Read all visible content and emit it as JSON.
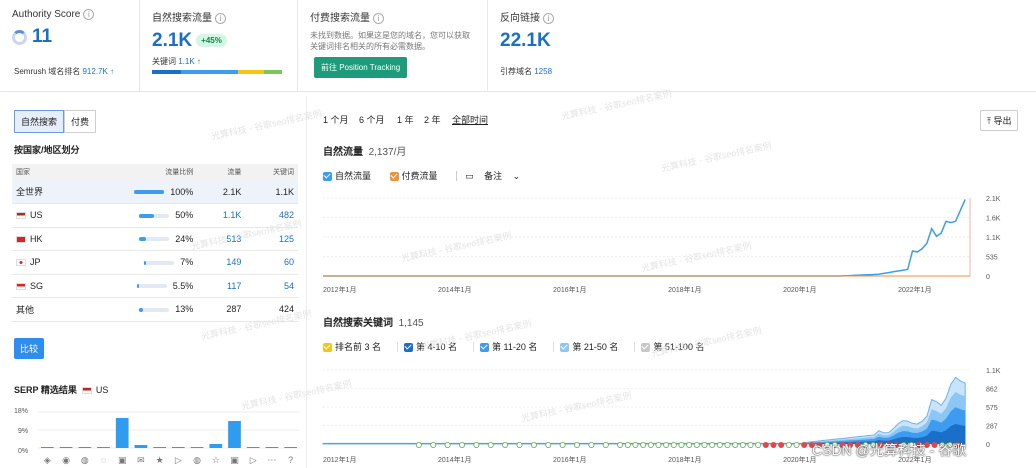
{
  "cards": {
    "authority": {
      "title": "Authority Score",
      "value": "11",
      "sub_label": "Semrush 域名排名",
      "sub_value": "912.7K ↑"
    },
    "organic": {
      "title": "自然搜索流量",
      "value": "2.1K",
      "badge": "+45%",
      "sub_label": "关键词",
      "sub_value": "1.1K ↑"
    },
    "paid": {
      "title": "付费搜索流量",
      "note": "未找到数据。如果这是您的域名，您可以获取关键词排名相关的所有必需数据。",
      "button": "前往 Position Tracking"
    },
    "backlinks": {
      "title": "反向链接",
      "value": "22.1K",
      "sub_label": "引荐域名",
      "sub_value": "1258"
    }
  },
  "left": {
    "tabs": [
      "自然搜索",
      "付费"
    ],
    "geo_title": "按国家/地区划分",
    "headers": [
      "国家",
      "流量比例",
      "流量",
      "关键词"
    ],
    "rows": [
      {
        "name": "全世界",
        "pct": "100%",
        "traffic": "2.1K",
        "keywords": "1.1K",
        "share": 1.0,
        "flag": "",
        "link": false
      },
      {
        "name": "US",
        "pct": "50%",
        "traffic": "1.1K",
        "keywords": "482",
        "share": 0.5,
        "flag": "us",
        "link": true
      },
      {
        "name": "HK",
        "pct": "24%",
        "traffic": "513",
        "keywords": "125",
        "share": 0.24,
        "flag": "hk",
        "link": true
      },
      {
        "name": "JP",
        "pct": "7%",
        "traffic": "149",
        "keywords": "60",
        "share": 0.07,
        "flag": "jp",
        "link": true
      },
      {
        "name": "SG",
        "pct": "5.5%",
        "traffic": "117",
        "keywords": "54",
        "share": 0.055,
        "flag": "sg",
        "link": true
      },
      {
        "name": "其他",
        "pct": "13%",
        "traffic": "287",
        "keywords": "424",
        "share": 0.13,
        "flag": "",
        "link": false
      }
    ],
    "compare_button": "比较",
    "serp_title": "SERP 精选结果",
    "serp_country": "US",
    "serp_ylabels": [
      "18%",
      "9%",
      "0%"
    ],
    "serp_values": [
      0.5,
      0.5,
      0.5,
      0.5,
      15,
      1.5,
      0.5,
      0.5,
      0.5,
      2,
      13.5,
      0.5,
      0.5,
      0.5
    ],
    "serp_icons": [
      "◈",
      "◉",
      "◍",
      "◌",
      "▣",
      "✉",
      "★",
      "▷",
      "◍",
      "☆",
      "▣",
      "▷",
      "⋯",
      "?"
    ]
  },
  "ranges": [
    "1 个月",
    "6 个月",
    "1 年",
    "2 年",
    "全部时间"
  ],
  "active_range": "全部时间",
  "export_label": "⤒ 导出",
  "traffic_chart": {
    "title": "自然流量",
    "value": "2,137/月",
    "legend": [
      {
        "label": "自然流量",
        "color": "#3b9ee8"
      },
      {
        "label": "付费流量",
        "color": "#f0923a"
      }
    ],
    "notes_label": "备注",
    "y_ticks": [
      "2.1K",
      "1.6K",
      "1.1K",
      "535",
      "0"
    ],
    "x_ticks": [
      "2012年1月",
      "2014年1月",
      "2016年1月",
      "2018年1月",
      "2020年1月",
      "2022年1月"
    ]
  },
  "keyword_chart": {
    "title": "自然搜索关键词",
    "value": "1,145",
    "legend": [
      {
        "label": "排名前 3 名",
        "color": "#f5c518"
      },
      {
        "label": "第 4-10 名",
        "color": "#1a6fc9"
      },
      {
        "label": "第 11-20 名",
        "color": "#3d9bf0"
      },
      {
        "label": "第 21-50 名",
        "color": "#8cc6f5"
      },
      {
        "label": "第 51-100 名",
        "color": "#c8c8c8"
      }
    ],
    "y_ticks": [
      "1.1K",
      "862",
      "575",
      "287",
      "0"
    ],
    "x_ticks": [
      "2012年1月",
      "2014年1月",
      "2016年1月",
      "2018年1月",
      "2020年1月",
      "2022年1月"
    ]
  },
  "watermark": "光算科技 - 谷歌seo排名案例",
  "credit": "CSDN @光算科技 - 谷歌"
}
